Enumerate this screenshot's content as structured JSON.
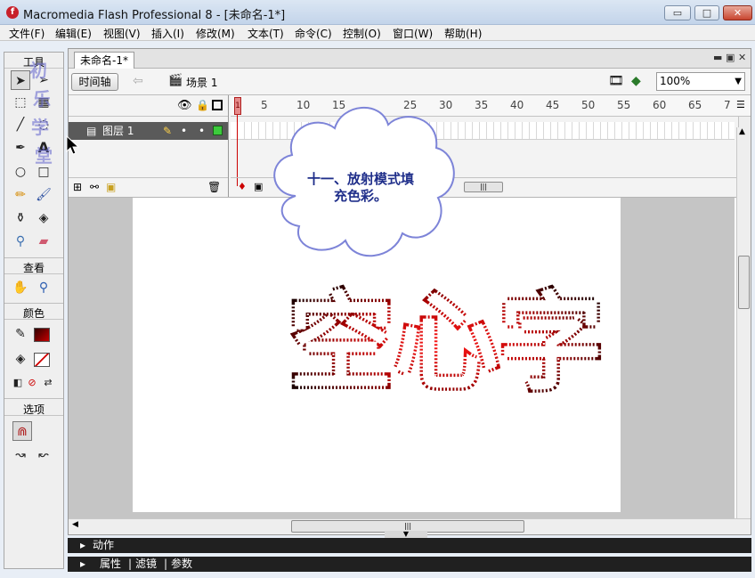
{
  "window": {
    "title": "Macromedia Flash Professional 8 - [未命名-1*]",
    "min_glyph": "▭",
    "max_glyph": "□",
    "close_glyph": "✕"
  },
  "menu": [
    "文件(F)",
    "编辑(E)",
    "视图(V)",
    "插入(I)",
    "修改(M)",
    "文本(T)",
    "命令(C)",
    "控制(O)",
    "窗口(W)",
    "帮助(H)"
  ],
  "tools": {
    "title": "工具",
    "view_title": "查看",
    "color_title": "颜色",
    "options_title": "选项",
    "stroke_color": "#000000",
    "fill_color": "#9a0000"
  },
  "document": {
    "tab": "未命名-1*",
    "timeline_button": "时间轴",
    "scene": "场景 1",
    "zoom": "100%"
  },
  "timeline": {
    "layer_name": "图层 1",
    "frame_numbers": [
      "1",
      "5",
      "10",
      "15",
      "25",
      "30",
      "35",
      "40",
      "45",
      "50",
      "55",
      "60",
      "65",
      "7"
    ]
  },
  "stage_text": "空心字",
  "callout": {
    "line1": "十一、放射模式填",
    "line2": "充色彩。"
  },
  "panels": {
    "actions": "动作",
    "properties": "属性",
    "filters": "滤镜",
    "params": "参数"
  },
  "watermark": [
    "初",
    "乐",
    "学",
    "堂"
  ]
}
